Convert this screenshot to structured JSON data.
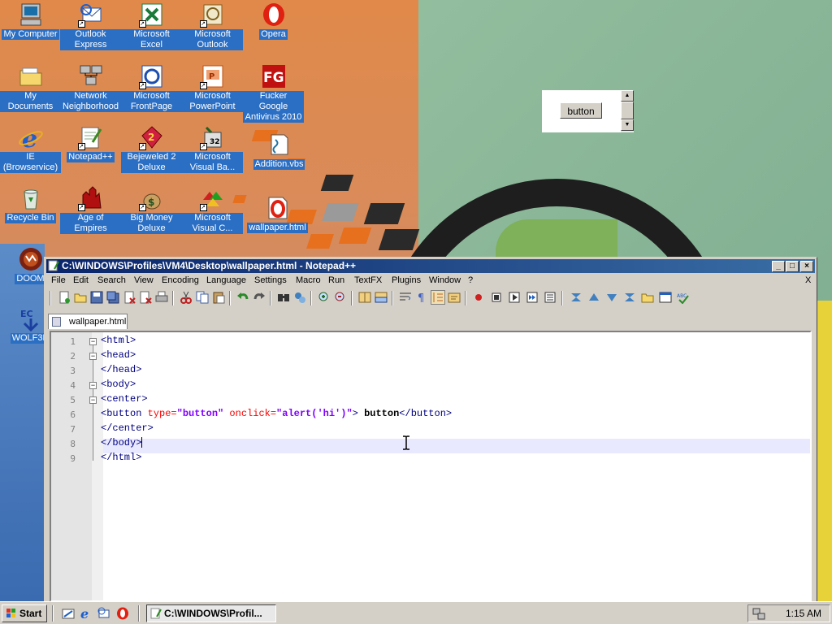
{
  "desktop": {
    "icons": [
      {
        "label": "My Computer",
        "icon": "my-computer-icon"
      },
      {
        "label": "Outlook Express",
        "icon": "outlook-express-icon"
      },
      {
        "label": "Microsoft Excel",
        "icon": "excel-icon"
      },
      {
        "label": "Microsoft Outlook",
        "icon": "outlook-icon"
      },
      {
        "label": "Opera",
        "icon": "opera-icon"
      },
      {
        "label": "My Documents",
        "icon": "folder-icon"
      },
      {
        "label": "Network Neighborhood",
        "icon": "network-icon"
      },
      {
        "label": "Microsoft FrontPage",
        "icon": "frontpage-icon"
      },
      {
        "label": "Microsoft PowerPoint",
        "icon": "powerpoint-icon"
      },
      {
        "label": "Fucker Google Antivirus 2010",
        "icon": "fg-antivirus-icon"
      },
      {
        "label": "IE (Browservice)",
        "icon": "ie-icon"
      },
      {
        "label": "Notepad++",
        "icon": "notepadpp-icon"
      },
      {
        "label": "Bejeweled 2 Deluxe",
        "icon": "bejeweled-icon"
      },
      {
        "label": "Microsoft Visual Ba...",
        "icon": "visual-basic-icon"
      },
      {
        "label": "Addition.vbs",
        "icon": "vbs-script-icon"
      },
      {
        "label": "Recycle Bin",
        "icon": "recycle-bin-icon"
      },
      {
        "label": "Age of Empires",
        "icon": "age-of-empires-icon"
      },
      {
        "label": "Big Money Deluxe",
        "icon": "big-money-icon"
      },
      {
        "label": "Microsoft Visual C...",
        "icon": "visual-c-icon"
      },
      {
        "label": "wallpaper.html",
        "icon": "opera-html-icon"
      },
      {
        "label": "DOOM",
        "icon": "doom-icon"
      },
      {
        "label": "WOLF3D",
        "icon": "wolf3d-icon"
      }
    ],
    "html_widget": {
      "button_label": "button"
    }
  },
  "window": {
    "title": "C:\\WINDOWS\\Profiles\\VM4\\Desktop\\wallpaper.html - Notepad++",
    "menu": [
      "File",
      "Edit",
      "Search",
      "View",
      "Encoding",
      "Language",
      "Settings",
      "Macro",
      "Run",
      "TextFX",
      "Plugins",
      "Window",
      "?"
    ],
    "menu_close": "X",
    "tab": "wallpaper.html",
    "lines": [
      {
        "n": "1",
        "code": "<html>"
      },
      {
        "n": "2",
        "code": "<head>"
      },
      {
        "n": "3",
        "code": "</head>"
      },
      {
        "n": "4",
        "code": "<body>"
      },
      {
        "n": "5",
        "code": "<center>"
      },
      {
        "n": "6",
        "tag_open": "<button ",
        "attr1": "type=",
        "val1": "\"button\"",
        "attr2": " onclick=",
        "val2": "\"alert('hi')\"",
        "tag_close": ">",
        "text": " button",
        "end_tag": "</button>"
      },
      {
        "n": "7",
        "code": "</center>"
      },
      {
        "n": "8",
        "code": "</body>"
      },
      {
        "n": "9",
        "code": "</html>"
      }
    ]
  },
  "taskbar": {
    "start_label": "Start",
    "task_label": "C:\\WINDOWS\\Profil...",
    "clock": "1:15 AM"
  }
}
